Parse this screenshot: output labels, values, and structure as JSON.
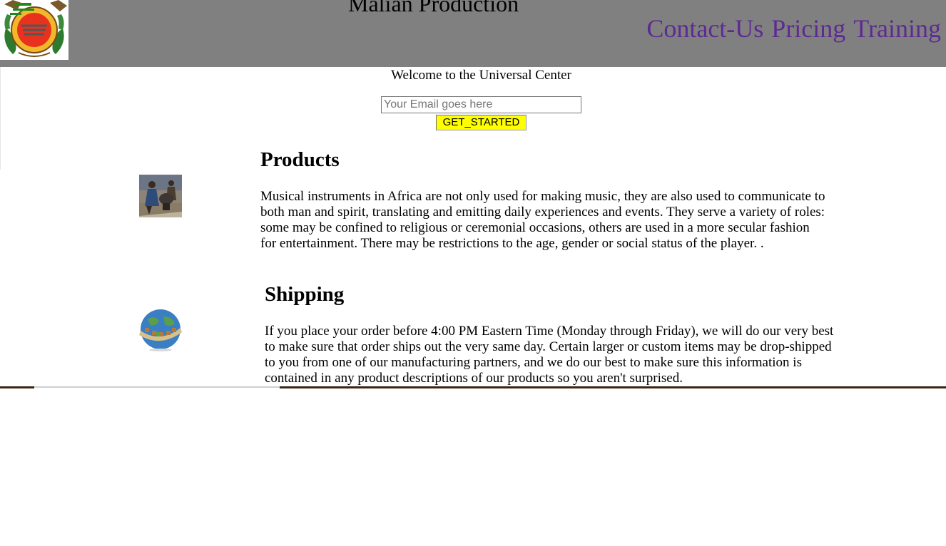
{
  "header": {
    "logo_alt": "Ville de Bamako coat of arms",
    "title": "Malian Production",
    "nav": [
      "Contact-Us",
      "Pricing",
      "Training"
    ]
  },
  "hero": {
    "welcome": "Welcome to the Universal Center",
    "email_placeholder": "Your Email goes here",
    "cta_label": "GET_STARTED"
  },
  "sections": [
    {
      "title": "Products",
      "image": "musicians-painting",
      "text": "Musical instruments in Africa are not only used for making music, they are also used to communicate to both man and spirit, translating and emitting daily experiences and events. They serve a variety of roles: some may be confined to religious or ceremonial occasions, others are used in a more secular fashion for entertainment. There may be restrictions to the age, gender or social status of the player. ."
    },
    {
      "title": "Shipping",
      "image": "globe-shipping-icon",
      "text": "If you place your order before 4:00 PM Eastern Time (Monday through Friday), we will do our very best to make sure that order ships out the very same day. Certain larger or custom items may be drop-shipped to you from one of our manufacturing partners, and we do our best to make sure this information is contained in any product descriptions of our products so you aren't surprised."
    }
  ],
  "colors": {
    "header_bg": "#808080",
    "nav_link": "#5d2a91",
    "cta_bg": "#ffff00",
    "divider": "#3d2510"
  }
}
